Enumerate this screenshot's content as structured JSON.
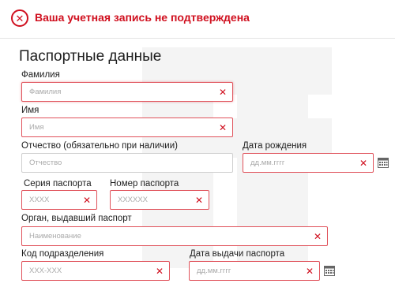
{
  "alert": {
    "icon": "close-circle-icon",
    "message": "Ваша учетная запись не подтверждена",
    "color": "#d0101f"
  },
  "section_title": "Паспортные данные",
  "fields": {
    "last_name": {
      "label": "Фамилия",
      "placeholder": "Фамилия",
      "value": ""
    },
    "first_name": {
      "label": "Имя",
      "placeholder": "Имя",
      "value": ""
    },
    "patronymic": {
      "label": "Отчество (обязательно при наличии)",
      "placeholder": "Отчество",
      "value": ""
    },
    "birth_date": {
      "label": "Дата рождения",
      "placeholder": "дд.мм.гггг",
      "value": "",
      "icon": "calendar-icon"
    },
    "passport_series": {
      "label": "Серия паспорта",
      "placeholder": "XXXX",
      "value": ""
    },
    "passport_number": {
      "label": "Номер паспорта",
      "placeholder": "XXXXXX",
      "value": ""
    },
    "issuing_authority": {
      "label": "Орган, выдавший паспорт",
      "placeholder": "Наименование",
      "value": ""
    },
    "department_code": {
      "label": "Код подразделения",
      "placeholder": "XXX-XXX",
      "value": ""
    },
    "issue_date": {
      "label": "Дата выдачи паспорта",
      "placeholder": "дд.мм.гггг",
      "value": "",
      "icon": "calendar-icon"
    }
  },
  "clear_symbol": "✕",
  "error_color": "#e0525b"
}
